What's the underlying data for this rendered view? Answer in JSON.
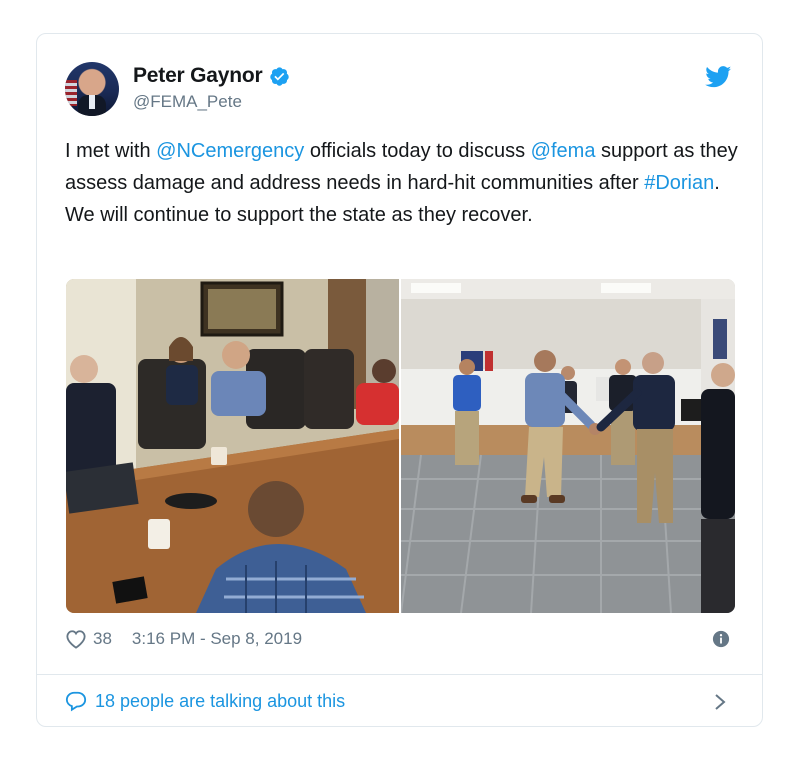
{
  "user": {
    "display_name": "Peter Gaynor",
    "handle": "@FEMA_Pete"
  },
  "tweet": {
    "part1": "I met with ",
    "mention1": "@NCemergency",
    "part2": " officials today to discuss ",
    "mention2": "@fema",
    "part3": " support as they assess damage and address needs in hard-hit communities after ",
    "hashtag": "#Dorian",
    "part4": ". We will continue to support the state as they recover."
  },
  "stats": {
    "likes": "38",
    "timestamp": "3:16 PM - Sep 8, 2019"
  },
  "footer": {
    "talking": "18 people are talking about this"
  },
  "colors": {
    "link": "#1b95e0",
    "muted": "#657786",
    "border": "#e1e8ed"
  },
  "icons": [
    "verified-badge-icon",
    "twitter-bird-icon",
    "heart-icon",
    "info-icon",
    "speech-bubble-icon",
    "chevron-right-icon"
  ]
}
